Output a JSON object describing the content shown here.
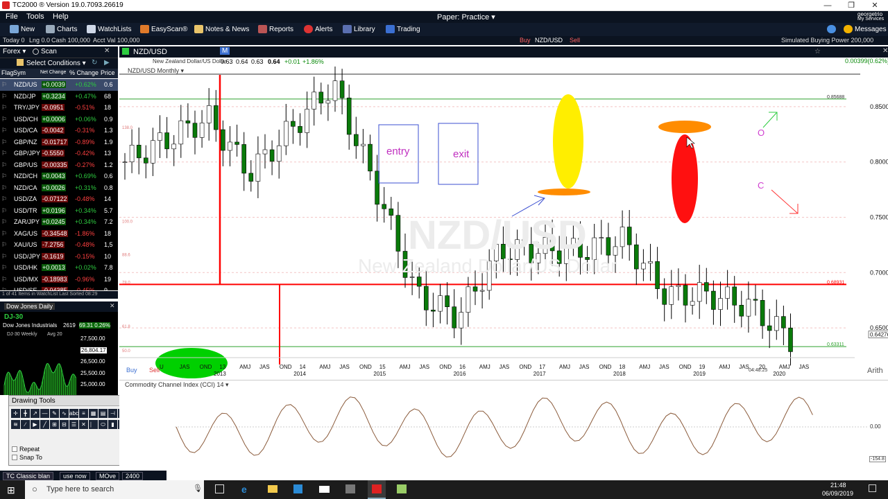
{
  "window": {
    "title": "TC2000 ® Version 19.0.7093.26619",
    "minimize": "—",
    "restore": "❐",
    "close": "✕"
  },
  "menu": {
    "file": "File",
    "tools": "Tools",
    "help": "Help",
    "mode": "Paper: Practice ▾",
    "brand_line1": "georgetrio",
    "brand_line2": "My Services"
  },
  "toolbar": {
    "new": "New",
    "charts": "Charts",
    "watchlists": "WatchLists",
    "easyscan": "EasyScan®",
    "notes": "Notes & News",
    "reports": "Reports",
    "alerts": "Alerts",
    "library": "Library",
    "trading": "Trading",
    "messages": "Messages"
  },
  "status": {
    "today": "Today 0",
    "lng": "Lng 0.0",
    "cash": "Cash 100,000",
    "acct": "Acct Val 100,000",
    "buy": "Buy",
    "symbol": "NZD/USD",
    "sell": "Sell",
    "buying_power": "Simulated Buying Power 200,000"
  },
  "watchlist": {
    "title": "Forex ▾",
    "scan": "Scan",
    "select": "Select Conditions ▾",
    "col_flag": "Flag",
    "col_sym": "Sym",
    "col_net": "Net Change",
    "col_pct": "% Change",
    "col_price": "Price",
    "rows": [
      {
        "sym": "NZD/US",
        "net": "+0.0039",
        "pct": "+0.62%",
        "price": "0.6",
        "up": true
      },
      {
        "sym": "NZD/JP",
        "net": "+0.3234",
        "pct": "+0.47%",
        "price": "68",
        "up": true
      },
      {
        "sym": "TRY/JPY",
        "net": "-0.0951",
        "pct": "-0.51%",
        "price": "18",
        "up": false
      },
      {
        "sym": "USD/CH",
        "net": "+0.0006",
        "pct": "+0.06%",
        "price": "0.9",
        "up": true
      },
      {
        "sym": "USD/CA",
        "net": "-0.0042",
        "pct": "-0.31%",
        "price": "1.3",
        "up": false
      },
      {
        "sym": "GBP/NZ",
        "net": "-0.01717",
        "pct": "-0.89%",
        "price": "1.9",
        "up": false
      },
      {
        "sym": "GBP/JPY",
        "net": "-0.5550",
        "pct": "-0.42%",
        "price": "13",
        "up": false
      },
      {
        "sym": "GBP/US",
        "net": "-0.00335",
        "pct": "-0.27%",
        "price": "1.2",
        "up": false
      },
      {
        "sym": "NZD/CH",
        "net": "+0.0043",
        "pct": "+0.69%",
        "price": "0.6",
        "up": true
      },
      {
        "sym": "NZD/CA",
        "net": "+0.0026",
        "pct": "+0.31%",
        "price": "0.8",
        "up": true
      },
      {
        "sym": "USD/ZA",
        "net": "-0.07122",
        "pct": "-0.48%",
        "price": "14",
        "up": false
      },
      {
        "sym": "USD/TR",
        "net": "+0.0196",
        "pct": "+0.34%",
        "price": "5.7",
        "up": true
      },
      {
        "sym": "ZAR/JPY",
        "net": "+0.0245",
        "pct": "+0.34%",
        "price": "7.2",
        "up": true
      },
      {
        "sym": "XAG/US",
        "net": "-0.34548",
        "pct": "-1.86%",
        "price": "18",
        "up": false
      },
      {
        "sym": "XAU/US",
        "net": "-7.2756",
        "pct": "-0.48%",
        "price": "1,5",
        "up": false
      },
      {
        "sym": "USD/JPY",
        "net": "-0.1619",
        "pct": "-0.15%",
        "price": "10",
        "up": false
      },
      {
        "sym": "USD/HK",
        "net": "+0.0013",
        "pct": "+0.02%",
        "price": "7.8",
        "up": true
      },
      {
        "sym": "USD/MX",
        "net": "-0.18983",
        "pct": "-0.96%",
        "price": "19",
        "up": false
      },
      {
        "sym": "USD/SE",
        "net": "-0.04385",
        "pct": "-0.45%",
        "price": "9.",
        "up": false
      }
    ],
    "footer": "1 of 41 Items in WatchList   Last Sorted 08:29"
  },
  "dow": {
    "title": "Dow Jones Daily",
    "symbol": "DJ-30",
    "name": "Dow Jones Industrials",
    "value": "2619",
    "change": "69.31 0.26%",
    "sub": "DJ-30 Weekly",
    "avg": "Avg 20",
    "scale": [
      "27,500.00",
      "26,804.17",
      "26,500.00",
      "25,500.00",
      "25,000.00"
    ]
  },
  "drawing_tools": {
    "title": "Drawing Tools",
    "repeat": "Repeat",
    "snap": "Snap To"
  },
  "bottom_tabs": [
    "TC Classic blan",
    "use now",
    "MOve",
    "2400"
  ],
  "taskbar": {
    "search_placeholder": "Type here to search",
    "time": "21:48",
    "date": "06/09/2019"
  },
  "chart": {
    "symbol": "NZD/USD",
    "desc": "New Zealand Dollar/US Dollar",
    "ohlc": [
      "0.63",
      "0.64",
      "0.63",
      "0.64",
      "+0.01",
      "+1.86%"
    ],
    "period": "NZD/USD Monthly ▾",
    "change": "0.00399(0.62%)",
    "buy": "Buy",
    "sell": "Sell",
    "watermark1": "NZD/USD",
    "watermark2": "New Zealand Dollar/US Dollar",
    "price_labels": [
      "0.85000",
      "0.80000",
      "0.75000",
      "0.70000",
      "0.65000"
    ],
    "level_labels": [
      "0.85688",
      "0.68931",
      "0.63311",
      "0.64276"
    ],
    "fib_labels": [
      "138.0",
      "100.0",
      "88.6",
      "78.0",
      "61.8",
      "50.0"
    ],
    "x_months": [
      "U",
      "JAS",
      "OND",
      "13",
      "AMJ",
      "JAS",
      "OND",
      "14",
      "AMJ",
      "JAS",
      "OND",
      "15",
      "AMJ",
      "JAS",
      "OND",
      "16",
      "AMJ",
      "JAS",
      "OND",
      "17",
      "AMJ",
      "JAS",
      "OND",
      "18",
      "AMJ",
      "JAS",
      "OND",
      "19",
      "AMJ",
      "JAS",
      "20",
      "AMJ",
      "JAS"
    ],
    "x_years": [
      "2013",
      "2014",
      "2015",
      "2016",
      "2017",
      "2018",
      "2019",
      "2020"
    ],
    "timestamp": "04:48:25",
    "scale_mode": "Arith",
    "annotation_entry": "entry",
    "annotation_exit": "exit",
    "annotation_o": "O",
    "annotation_c": "C",
    "indicator": "Commodity Channel Index (CCI) 14 ▾",
    "cci_zero": "0.00",
    "cci_low": "-154.8",
    "colors": {
      "up": "#ffffff",
      "down": "#0a7a0a",
      "red_line": "#ff0000",
      "green_line": "#2ca02c"
    }
  },
  "chart_data": {
    "type": "candlestick",
    "title": "NZD/USD Monthly",
    "ylabel": "",
    "ylim": [
      0.62,
      0.88
    ],
    "x": [
      "2012-06",
      "2012-09",
      "2013-01",
      "2013-06",
      "2014-01",
      "2014-06",
      "2015-01",
      "2015-06",
      "2016-01",
      "2016-06",
      "2017-01",
      "2017-06",
      "2018-01",
      "2018-06",
      "2019-01",
      "2019-06",
      "2019-09"
    ],
    "close": [
      0.8,
      0.82,
      0.84,
      0.79,
      0.83,
      0.87,
      0.78,
      0.68,
      0.66,
      0.72,
      0.72,
      0.72,
      0.73,
      0.68,
      0.68,
      0.67,
      0.64
    ],
    "levels": [
      {
        "name": "resistance",
        "value": 0.85688
      },
      {
        "name": "support",
        "value": 0.68931
      },
      {
        "name": "low",
        "value": 0.63311
      }
    ]
  }
}
